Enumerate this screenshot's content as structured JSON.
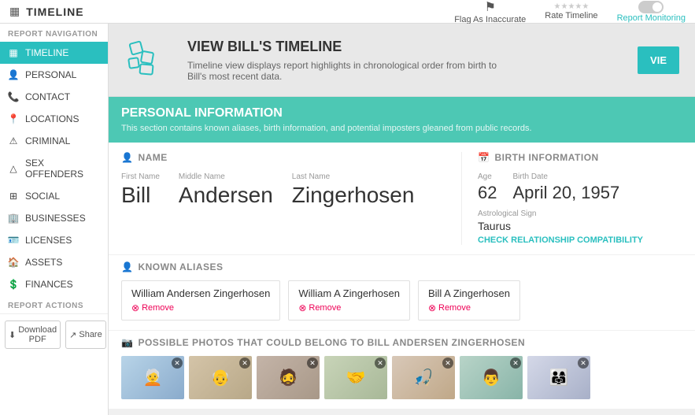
{
  "header": {
    "title": "TIMELINE",
    "icon": "timeline-icon",
    "actions": {
      "flag_label": "Flag As Inaccurate",
      "rate_label": "Rate Timeline",
      "monitor_label": "Report Monitoring",
      "stars": "★★★★★"
    }
  },
  "sidebar": {
    "report_nav_label": "REPORT NAVIGATION",
    "items": [
      {
        "id": "timeline",
        "label": "TIMELINE",
        "active": true,
        "icon": "grid"
      },
      {
        "id": "personal",
        "label": "PERSONAL",
        "active": false,
        "icon": "person"
      },
      {
        "id": "contact",
        "label": "CONTACT",
        "active": false,
        "icon": "phone"
      },
      {
        "id": "locations",
        "label": "LOCATIONS",
        "active": false,
        "icon": "pin"
      },
      {
        "id": "criminal",
        "label": "CRIMINAL",
        "active": false,
        "icon": "warning"
      },
      {
        "id": "sex-offenders",
        "label": "SEX OFFENDERS",
        "active": false,
        "icon": "alert-triangle"
      },
      {
        "id": "social",
        "label": "SOCIAL",
        "active": false,
        "icon": "grid2"
      },
      {
        "id": "businesses",
        "label": "BUSINESSES",
        "active": false,
        "icon": "building"
      },
      {
        "id": "licenses",
        "label": "LICENSES",
        "active": false,
        "icon": "card"
      },
      {
        "id": "assets",
        "label": "ASSETS",
        "active": false,
        "icon": "home"
      },
      {
        "id": "finances",
        "label": "FINANCES",
        "active": false,
        "icon": "dollar"
      }
    ],
    "report_actions_label": "REPORT ACTIONS",
    "download_label": "Download PDF",
    "share_label": "Share"
  },
  "timeline_banner": {
    "title": "VIEW BILL'S TIMELINE",
    "description": "Timeline view displays report highlights in chronological order from birth to Bill's most recent data.",
    "view_button": "VIE"
  },
  "personal": {
    "section_title": "PERSONAL INFORMATION",
    "section_desc": "This section contains known aliases, birth information, and potential imposters gleaned from public records.",
    "name_section_label": "NAME",
    "birth_section_label": "BIRTH INFORMATION",
    "first_name_label": "First Name",
    "first_name": "Bill",
    "middle_name_label": "Middle Name",
    "middle_name": "Andersen",
    "last_name_label": "Last Name",
    "last_name": "Zingerhosen",
    "age_label": "Age",
    "age": "62",
    "birth_date_label": "Birth Date",
    "birth_date": "April 20, 1957",
    "astro_label": "Astrological Sign",
    "astro_val": "Taurus",
    "compat_link": "CHECK RELATIONSHIP COMPATIBILITY",
    "aliases_label": "KNOWN ALIASES",
    "aliases": [
      {
        "name": "William Andersen Zingerhosen",
        "remove": "Remove"
      },
      {
        "name": "William A Zingerhosen",
        "remove": "Remove"
      },
      {
        "name": "Bill A Zingerhosen",
        "remove": "Remove"
      }
    ],
    "photos_label": "POSSIBLE PHOTOS THAT COULD BELONG TO BILL ANDERSEN ZINGERHOSEN",
    "photos": [
      {
        "id": 1,
        "bg": "photo-1"
      },
      {
        "id": 2,
        "bg": "photo-2"
      },
      {
        "id": 3,
        "bg": "photo-3"
      },
      {
        "id": 4,
        "bg": "photo-4"
      },
      {
        "id": 5,
        "bg": "photo-5"
      },
      {
        "id": 6,
        "bg": "photo-6"
      },
      {
        "id": 7,
        "bg": "photo-7"
      }
    ]
  }
}
